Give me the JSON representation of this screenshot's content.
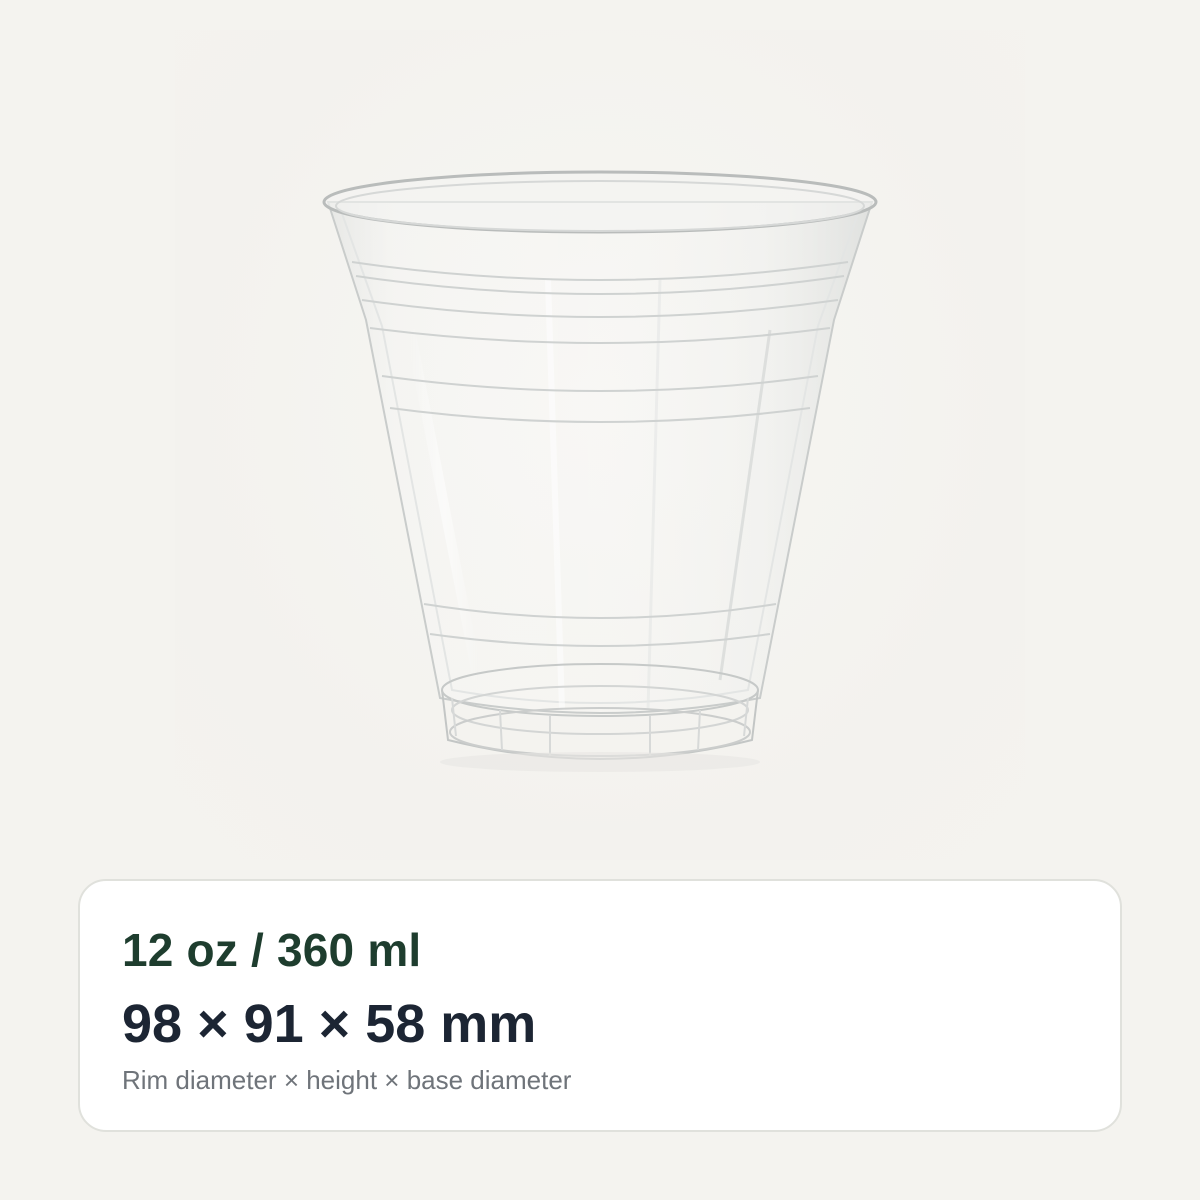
{
  "product": {
    "image": "clear-plastic-cup",
    "background_color": "#f4f3ef"
  },
  "spec_card": {
    "capacity": "12 oz / 360 ml",
    "dimensions": "98 × 91 × 58 mm",
    "dimensions_caption": "Rim diameter × height × base diameter",
    "colors": {
      "capacity": "#1e3d2e",
      "dimensions": "#1c2533",
      "caption": "#6f747a"
    }
  }
}
